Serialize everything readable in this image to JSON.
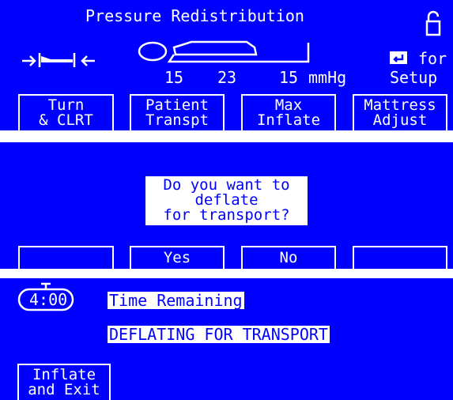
{
  "screen1": {
    "title": "Pressure Redistribution",
    "lock_icon": "padlock-icon",
    "patient_icon": "patient-on-mattress-icon",
    "head_elevation_icon": "head-angle-icon",
    "pressures": [
      "15",
      "23",
      "15"
    ],
    "pressure_unit": "mmHg",
    "setup_hint_icon": "enter-key-icon",
    "setup_hint_line1": "for",
    "setup_hint_line2": "Setup",
    "softkeys": [
      {
        "line1": "Turn",
        "line2": "& CLRT"
      },
      {
        "line1": "Patient",
        "line2": "Transpt"
      },
      {
        "line1": "Max",
        "line2": "Inflate"
      },
      {
        "line1": "Mattress",
        "line2": "Adjust"
      }
    ]
  },
  "screen2": {
    "prompt_line1": "Do you want to",
    "prompt_line2": "deflate",
    "prompt_line3": "for transport?",
    "softkeys": [
      "",
      "Yes",
      "No",
      ""
    ]
  },
  "screen3": {
    "timer_icon": "stopwatch-icon",
    "timer": "4:00",
    "time_label": "Time Remaining",
    "status": "DEFLATING FOR TRANSPORT",
    "softkey_line1": "Inflate",
    "softkey_line2": "and Exit"
  }
}
